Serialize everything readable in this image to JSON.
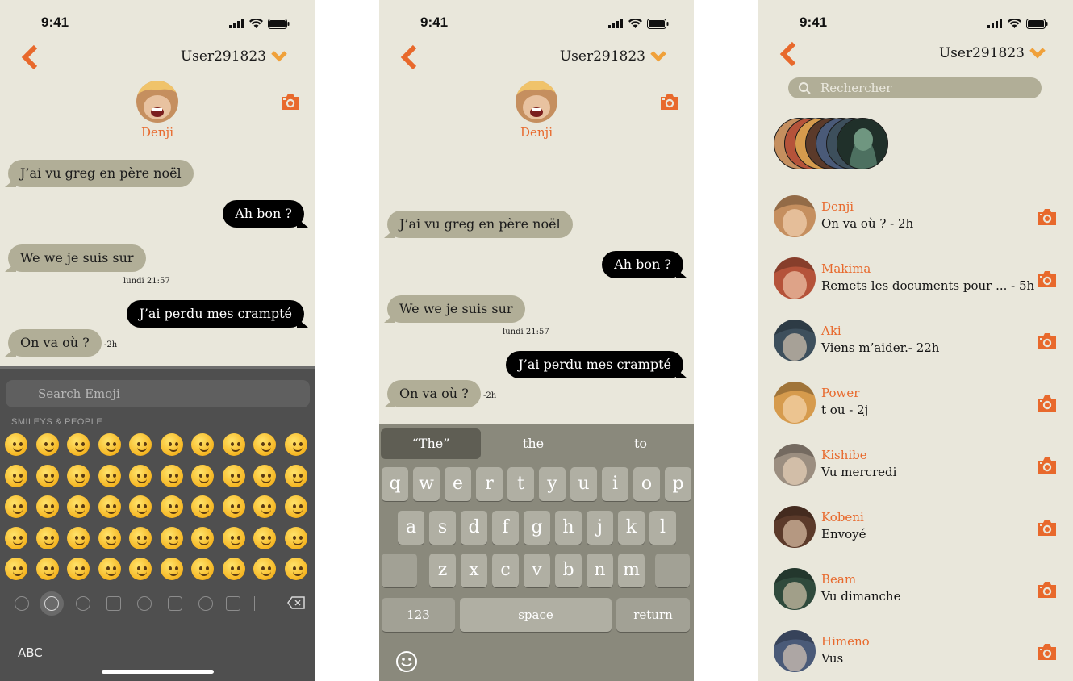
{
  "status": {
    "time": "9:41"
  },
  "chat": {
    "header_user": "User291823",
    "contact_name": "Denji",
    "messages": [
      {
        "dir": "in",
        "text": "J’ai vu greg en père noël"
      },
      {
        "dir": "out",
        "text": "Ah bon ?"
      },
      {
        "dir": "in",
        "text": "We we je suis sur"
      },
      {
        "dir": "out",
        "text": "J’ai perdu mes crampté"
      },
      {
        "dir": "in",
        "text": "On va où ?"
      }
    ],
    "stamp_day": "lundi 21:57",
    "stamp_last": "-2h"
  },
  "emoji_keyboard": {
    "search_placeholder": "Search Emoji",
    "category": "SMILEYS & PEOPLE",
    "abc_label": "ABC"
  },
  "keyboard": {
    "suggestions": [
      "“The”",
      "the",
      "to"
    ],
    "row1": [
      "q",
      "w",
      "e",
      "r",
      "t",
      "y",
      "u",
      "i",
      "o",
      "p"
    ],
    "row2": [
      "a",
      "s",
      "d",
      "f",
      "g",
      "h",
      "j",
      "k",
      "l"
    ],
    "row3": [
      "z",
      "x",
      "c",
      "v",
      "b",
      "n",
      "m"
    ],
    "num_label": "123",
    "space_label": "space",
    "return_label": "return"
  },
  "list": {
    "header_user": "User291823",
    "search_placeholder": "Rechercher",
    "conversations": [
      {
        "name": "Denji",
        "message": "On va où ? - 2h",
        "color": "#c58f5f"
      },
      {
        "name": "Makima",
        "message": "Remets les documents pour ... - 5h",
        "color": "#b5533a"
      },
      {
        "name": "Aki",
        "message": "Viens m’aider.- 22h",
        "color": "#3d4f5c"
      },
      {
        "name": "Power",
        "message": "t ou - 2j",
        "color": "#d69b4d"
      },
      {
        "name": "Kishibe",
        "message": "Vu mercredi",
        "color": "#9b8e80"
      },
      {
        "name": "Kobeni",
        "message": "Envoyé",
        "color": "#5b3a2a"
      },
      {
        "name": "Beam",
        "message": "Vu dimanche",
        "color": "#2f4a3c"
      },
      {
        "name": "Himeno",
        "message": "Vus",
        "color": "#4a5a78"
      }
    ]
  },
  "colors": {
    "accent": "#e8692c",
    "background": "#e9e7db",
    "incoming_bubble": "#b1ae97",
    "outgoing_bubble": "#000000"
  }
}
